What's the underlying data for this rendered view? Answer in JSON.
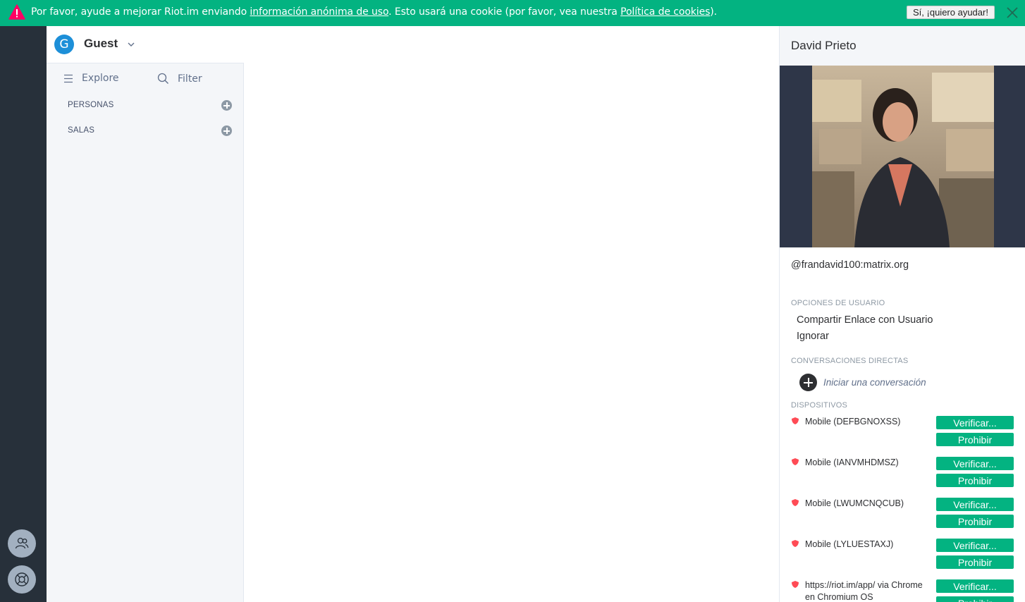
{
  "banner": {
    "text_before": "Por favor, ayude a mejorar Riot.im enviando ",
    "link1": "información anónima de uso",
    "text_middle": ". Esto usará una cookie (por favor, vea nuestra ",
    "link2": "Política de cookies",
    "text_after": ").",
    "accept_label": "Sí, ¡quiero ayudar!",
    "icon": "warning-icon",
    "close_icon": "close-icon"
  },
  "leftbar": {
    "buttons": [
      {
        "icon": "people-icon"
      },
      {
        "icon": "help-lifebuoy-icon"
      }
    ]
  },
  "roomlist": {
    "user": {
      "initial": "G",
      "name": "Guest"
    },
    "explore_label": "Explore",
    "filter_label": "Filter",
    "sections": [
      {
        "label": "PERSONAS"
      },
      {
        "label": "SALAS"
      }
    ]
  },
  "right_panel": {
    "name": "David Prieto",
    "mxid": "@frandavid100:matrix.org",
    "user_options_title": "OPCIONES DE USUARIO",
    "user_options": [
      "Compartir Enlace con Usuario",
      "Ignorar"
    ],
    "direct_title": "CONVERSACIONES DIRECTAS",
    "start_chat_label": "Iniciar una conversación",
    "devices_title": "DISPOSITIVOS",
    "verify_label": "Verificar...",
    "block_label": "Prohibir",
    "devices": [
      {
        "name": "Mobile (DEFBGNOXSS)"
      },
      {
        "name": "Mobile (IANVMHDMSZ)"
      },
      {
        "name": "Mobile (LWUMCNQCUB)"
      },
      {
        "name": "Mobile (LYLUESTAXJ)"
      },
      {
        "name": "https://riot.im/app/ via Chrome en Chromium OS"
      }
    ]
  },
  "colors": {
    "accent": "#03b381",
    "leftbar_bg": "#27303a",
    "warning": "#ff0064",
    "unverified": "#ff4b55"
  }
}
